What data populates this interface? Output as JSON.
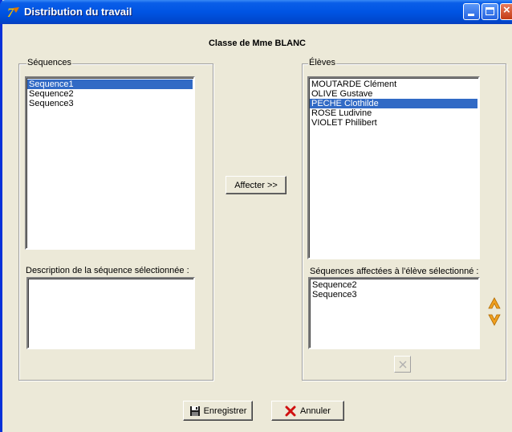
{
  "window": {
    "title": "Distribution du travail",
    "class_title": "Classe de Mme BLANC"
  },
  "sequences": {
    "legend": "Séquences",
    "items": [
      "Sequence1",
      "Sequence2",
      "Sequence3"
    ],
    "selected_index": 0,
    "description_label": "Description de la séquence sélectionnée :",
    "description_value": ""
  },
  "eleves": {
    "legend": "Élèves",
    "items": [
      "MOUTARDE Clément",
      "OLIVE Gustave",
      "PECHE Clothilde",
      "ROSE Ludivine",
      "VIOLET Philibert"
    ],
    "selected_index": 2,
    "assigned_label": "Séquences affectées à l'élève sélectionné :",
    "assigned_items": [
      "Sequence2",
      "Sequence3"
    ]
  },
  "buttons": {
    "affecter": "Affecter >>",
    "enregistrer": "Enregistrer",
    "annuler": "Annuler"
  },
  "colors": {
    "titlebar": "#0054e3",
    "selection": "#316ac5",
    "dialog_bg": "#ece9d8",
    "arrow_orange": "#f0a020"
  }
}
